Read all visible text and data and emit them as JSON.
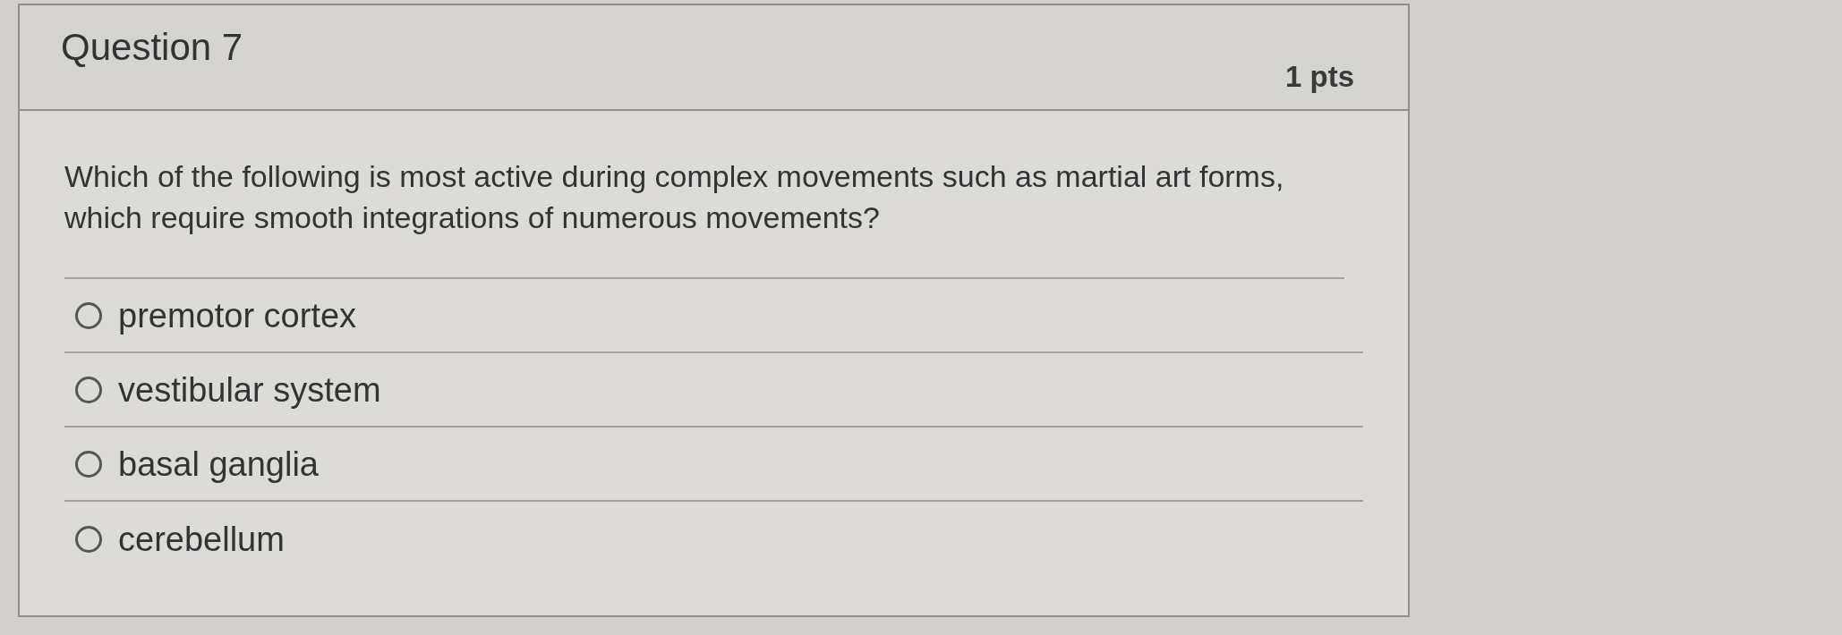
{
  "question": {
    "title": "Question 7",
    "points": "1 pts",
    "text": "Which of the following is most active during complex movements such as martial art forms, which require smooth integrations of numerous movements?"
  },
  "answers": [
    {
      "label": "premotor cortex",
      "selected": false
    },
    {
      "label": "vestibular system",
      "selected": false
    },
    {
      "label": "basal ganglia",
      "selected": false
    },
    {
      "label": "cerebellum",
      "selected": false
    }
  ]
}
